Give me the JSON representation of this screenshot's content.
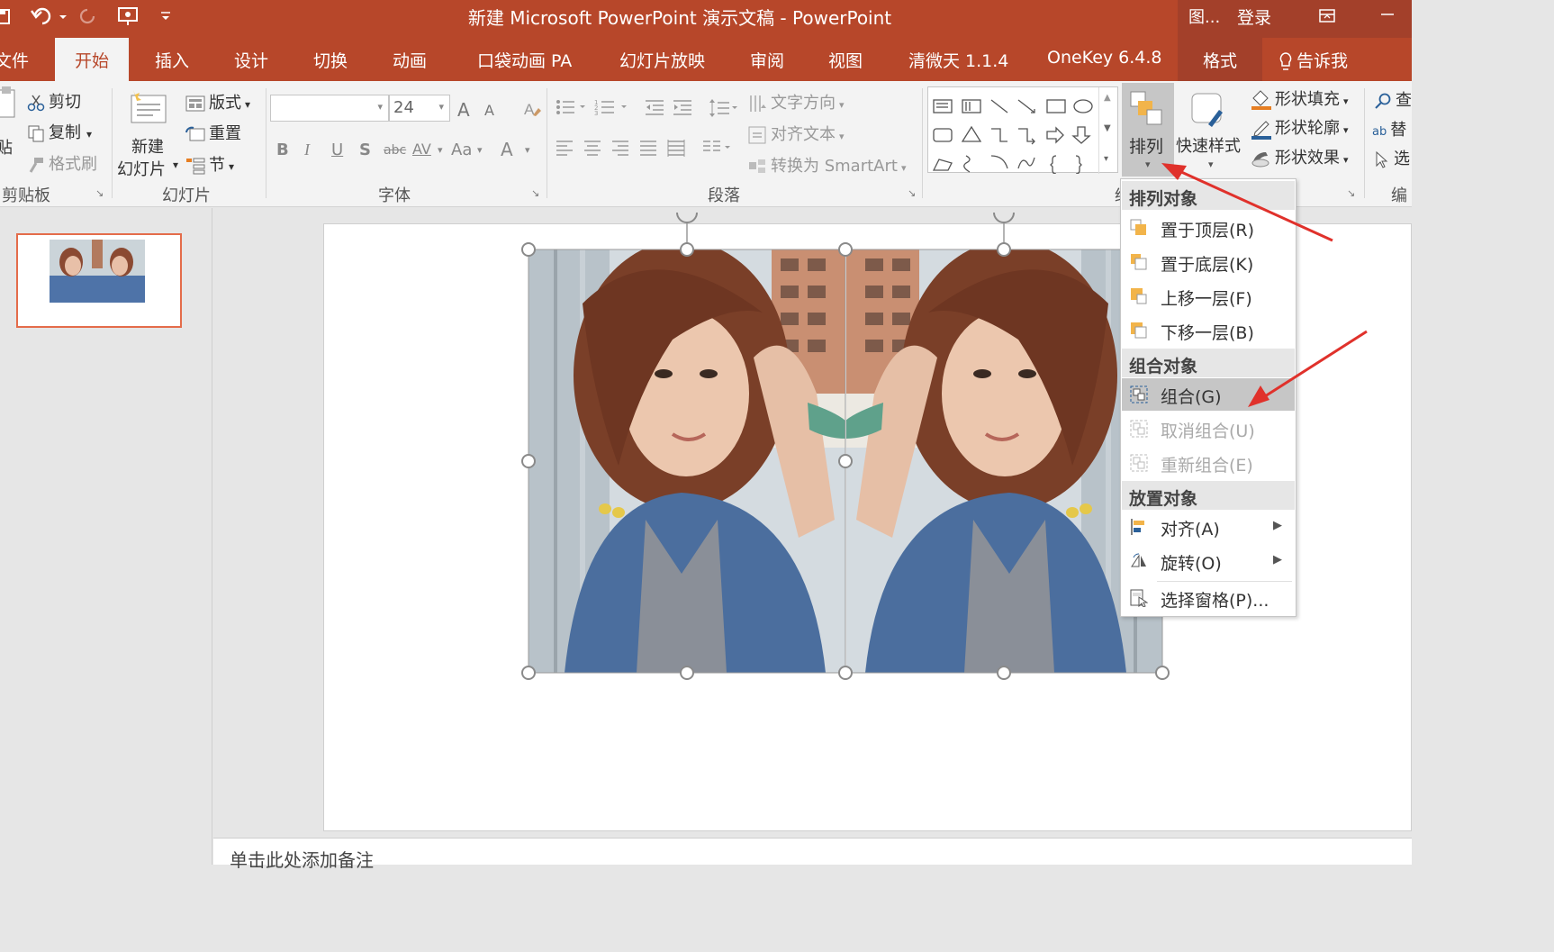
{
  "window": {
    "title": "新建 Microsoft PowerPoint 演示文稿  -  PowerPoint",
    "pic_label": "图...",
    "login": "登录"
  },
  "tabs": {
    "file": "文件",
    "home": "开始",
    "insert": "插入",
    "design": "设计",
    "transition": "切换",
    "animation": "动画",
    "pocket": "口袋动画 PA",
    "slideshow": "幻灯片放映",
    "review": "审阅",
    "view": "视图",
    "qingwei": "清微天 1.1.4",
    "onekey": "OneKey 6.4.8",
    "format": "格式",
    "tellme": "告诉我"
  },
  "ribbon": {
    "clipboard": {
      "paste": "贴",
      "cut": "剪切",
      "copy": "复制",
      "format_painter": "格式刷",
      "label": "剪贴板"
    },
    "slides": {
      "new_slide_1": "新建",
      "new_slide_2": "幻灯片",
      "layout": "版式",
      "reset": "重置",
      "section": "节",
      "label": "幻灯片"
    },
    "font": {
      "font_name": "",
      "font_size": "24",
      "bold": "B",
      "italic": "I",
      "underline": "U",
      "shadow": "S",
      "strike": "abc",
      "spacing": "AV",
      "case": "Aa",
      "color": "A",
      "grow": "A",
      "shrink": "A",
      "label": "字体"
    },
    "paragraph": {
      "text_direction": "文字方向",
      "align_text": "对齐文本",
      "smartart": "转换为 SmartArt",
      "label": "段落"
    },
    "drawing": {
      "arrange": "排列",
      "quick_styles": "快速样式",
      "shape_fill": "形状填充",
      "shape_outline": "形状轮廓",
      "shape_effects": "形状效果"
    },
    "editing": {
      "find": "查",
      "replace": "替",
      "select": "选",
      "label": "编"
    },
    "drawing_label_fragment": "绉"
  },
  "notes": {
    "placeholder": "单击此处添加备注"
  },
  "arrange_menu": {
    "order_header": "排列对象",
    "bring_front": "置于顶层(R)",
    "send_back": "置于底层(K)",
    "bring_forward": "上移一层(F)",
    "send_backward": "下移一层(B)",
    "group_header": "组合对象",
    "group": "组合(G)",
    "ungroup": "取消组合(U)",
    "regroup": "重新组合(E)",
    "position_header": "放置对象",
    "align": "对齐(A)",
    "rotate": "旋转(O)",
    "selection_pane": "选择窗格(P)..."
  },
  "colors": {
    "accent": "#b7472a",
    "arrow": "#e0312b"
  }
}
